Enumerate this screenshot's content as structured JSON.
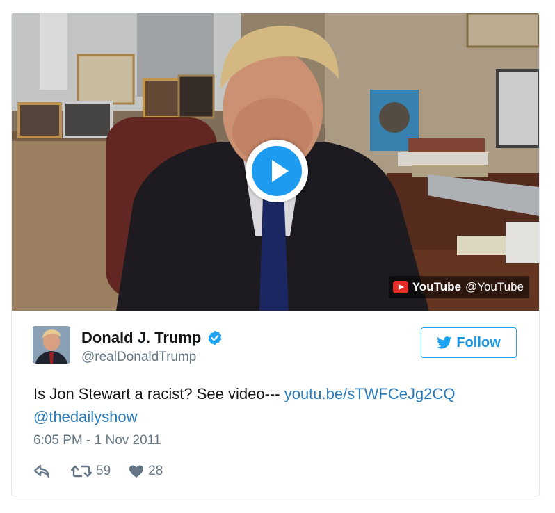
{
  "media": {
    "provider": "YouTube",
    "provider_handle": "@YouTube",
    "icons": {
      "play": "play-icon",
      "provider": "youtube-logo-icon"
    }
  },
  "tweet": {
    "display_name": "Donald J. Trump",
    "handle": "@realDonaldTrump",
    "follow_label": "Follow",
    "text_plain": "Is Jon Stewart a racist? See video--- ",
    "link": "youtu.be/sTWFCeJg2CQ",
    "mention": "@thedailyshow",
    "timestamp": "6:05 PM - 1 Nov 2011",
    "retweets": "59",
    "likes": "28"
  },
  "colors": {
    "accent": "#1da1f2",
    "link": "#2b7bb9",
    "secondary_text": "#657786",
    "youtube_red": "#e52d27"
  }
}
